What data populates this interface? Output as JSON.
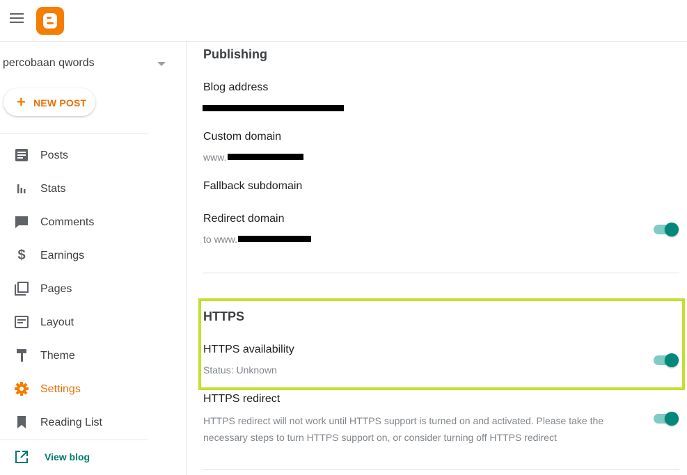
{
  "header": {
    "menu_icon": "hamburger-menu-icon",
    "logo_icon": "blogger-logo-icon"
  },
  "sidebar": {
    "blog_name": "percobaan qwords",
    "new_post_label": "NEW POST",
    "items": [
      {
        "label": "Posts",
        "icon": "posts-icon"
      },
      {
        "label": "Stats",
        "icon": "stats-icon"
      },
      {
        "label": "Comments",
        "icon": "comments-icon"
      },
      {
        "label": "Earnings",
        "icon": "dollar-icon"
      },
      {
        "label": "Pages",
        "icon": "pages-icon"
      },
      {
        "label": "Layout",
        "icon": "layout-icon"
      },
      {
        "label": "Theme",
        "icon": "paint-roller-icon"
      },
      {
        "label": "Settings",
        "icon": "gear-icon",
        "active": true
      },
      {
        "label": "Reading List",
        "icon": "bookmark-icon"
      }
    ],
    "view_blog_label": "View blog"
  },
  "publishing": {
    "title": "Publishing",
    "blog_address_label": "Blog address",
    "custom_domain_label": "Custom domain",
    "custom_domain_value": "www.",
    "fallback_subdomain_label": "Fallback subdomain",
    "redirect_domain_label": "Redirect domain",
    "redirect_domain_value": "to www.",
    "redirect_domain_enabled": true
  },
  "https": {
    "title": "HTTPS",
    "availability_label": "HTTPS availability",
    "availability_status": "Status: Unknown",
    "availability_enabled": true,
    "redirect_label": "HTTPS redirect",
    "redirect_description": "HTTPS redirect will not work until HTTPS support is turned on and activated. Please take the necessary steps to turn HTTPS support on, or consider turning off HTTPS redirect",
    "redirect_enabled": true
  },
  "colors": {
    "brand_orange": "#f57d00",
    "accent_teal": "#00897b",
    "highlight_green": "#c2e02e"
  }
}
